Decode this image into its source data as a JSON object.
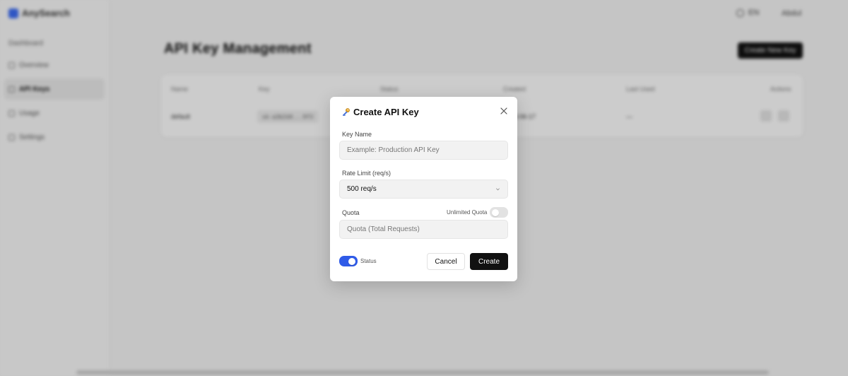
{
  "app": {
    "brand": "AnySearch",
    "sidebar": {
      "section": "Dashboard",
      "items": [
        {
          "label": "Overview",
          "icon": "overview-icon"
        },
        {
          "label": "API Keys",
          "icon": "key-icon",
          "active": true
        },
        {
          "label": "Usage",
          "icon": "usage-icon"
        },
        {
          "label": "Settings",
          "icon": "settings-icon"
        }
      ]
    },
    "topbar": {
      "lang": "EN",
      "user": "Abdul"
    },
    "page_title": "API Key Management",
    "new_key_button": "Create New Key",
    "table": {
      "headers": [
        "Name",
        "Key",
        "Status",
        "Created",
        "Last Used",
        "Actions"
      ],
      "rows": [
        {
          "name": "default",
          "key": "sk-a3b2d4...9f3",
          "created": "2025-06-17",
          "last_used": "—"
        }
      ]
    }
  },
  "modal": {
    "title": "Create API Key",
    "key_name": {
      "label": "Key Name",
      "placeholder": "Example: Production API Key",
      "value": ""
    },
    "rate_limit": {
      "label": "Rate Limit (req/s)",
      "value": "500 req/s"
    },
    "quota": {
      "label": "Quota",
      "unlimited_label": "Unlimited Quota",
      "unlimited": false,
      "placeholder": "Quota (Total Requests)",
      "value": ""
    },
    "status": {
      "label": "Status",
      "enabled": true
    },
    "cancel_label": "Cancel",
    "create_label": "Create"
  },
  "colors": {
    "accent": "#2f5be8",
    "primary_button": "#111111"
  }
}
